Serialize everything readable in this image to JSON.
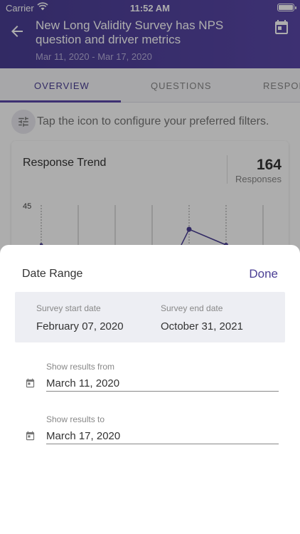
{
  "status_bar": {
    "carrier": "Carrier",
    "time": "11:52 AM"
  },
  "header": {
    "title": "New Long Validity Survey has NPS question and driver metrics",
    "date_range": "Mar 11, 2020 - Mar 17, 2020"
  },
  "tabs": [
    {
      "label": "OVERVIEW",
      "active": true
    },
    {
      "label": "QUESTIONS",
      "active": false
    },
    {
      "label": "RESPONSES",
      "active": false
    }
  ],
  "filter_hint": "Tap the icon to configure your preferred filters.",
  "card": {
    "title": "Response Trend",
    "count": "164",
    "count_label": "Responses",
    "y_tick": "45"
  },
  "sheet": {
    "title": "Date Range",
    "done_label": "Done",
    "survey_start_label": "Survey start date",
    "survey_start_value": "February 07, 2020",
    "survey_end_label": "Survey end date",
    "survey_end_value": "October 31, 2021",
    "from_label": "Show results from",
    "from_value": "March 11, 2020",
    "to_label": "Show results to",
    "to_value": "March 17, 2020"
  },
  "colors": {
    "accent": "#4a3e94",
    "header": "#5a48a8"
  }
}
